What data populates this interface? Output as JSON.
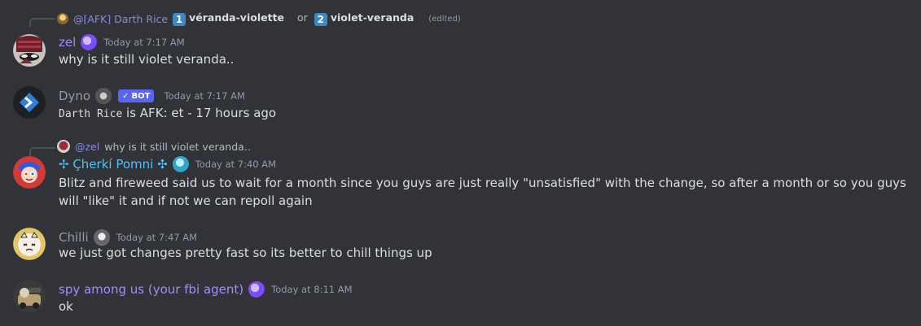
{
  "messages": [
    {
      "reply": {
        "name": "@[AFK] Darth Rice",
        "option1_num": "1",
        "option1": "véranda-violette",
        "or": "or",
        "option2_num": "2",
        "option2": "violet-veranda",
        "edited": "(edited)"
      },
      "author": "zel",
      "author_color": "#a78bfa",
      "timestamp": "Today at 7:17 AM",
      "text": "why is it still violet veranda.."
    },
    {
      "author": "Dyno",
      "author_color": "#b5bac1",
      "bot_tag": "BOT",
      "timestamp": "Today at 7:17 AM",
      "code": "Darth Rice",
      "text": " is AFK: et - 17 hours ago"
    },
    {
      "reply": {
        "name": "@zel",
        "text": "why is it still violet veranda.."
      },
      "author": "✢ Çherkí Pomni ✣",
      "author_color": "#4fc3f7",
      "timestamp": "Today at 7:40 AM",
      "text": "Blitz and fireweed said us to wait for a month since you guys are just really \"unsatisfied\" with the change, so after a month or so you guys will \"like\" it and if not we can repoll again"
    },
    {
      "author": "Chilli",
      "author_color": "#b5bac1",
      "timestamp": "Today at 7:47 AM",
      "text": "we just got changes pretty fast so its better to chill things up"
    },
    {
      "author": "spy among us (your fbi agent)",
      "author_color": "#a78bfa",
      "timestamp": "Today at 8:11 AM",
      "text": "ok"
    }
  ]
}
